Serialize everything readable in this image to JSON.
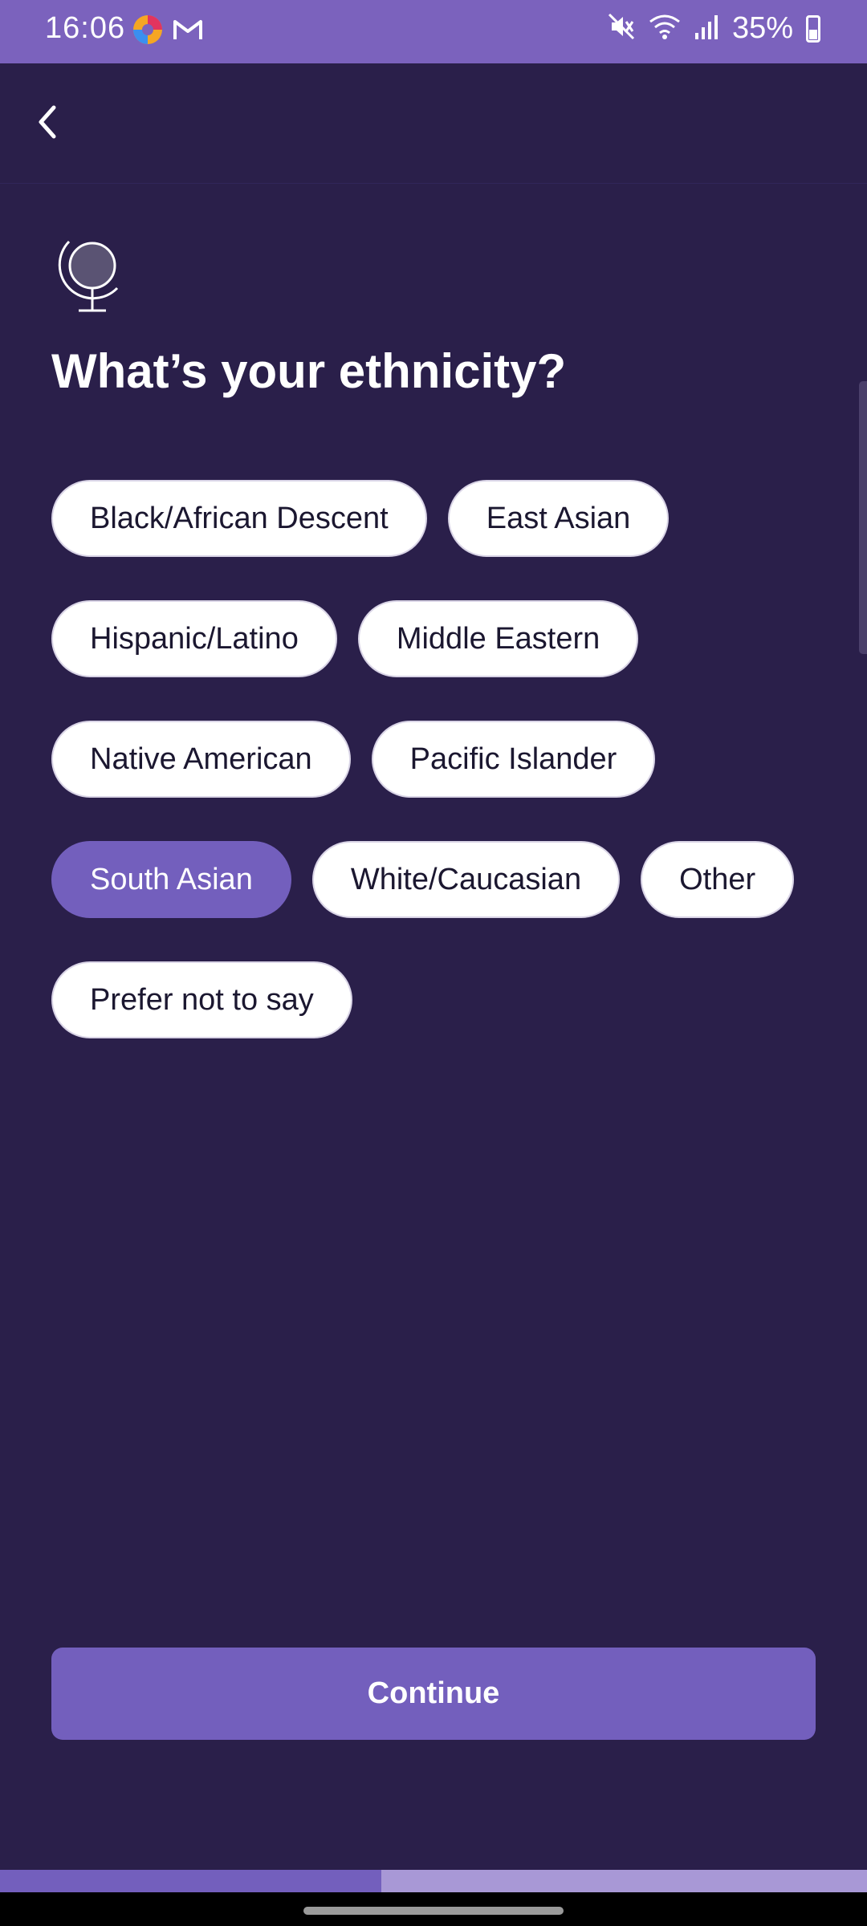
{
  "status_bar": {
    "time": "16:06",
    "battery_pct": "35%",
    "icons": [
      "firefox-icon",
      "gmail-icon",
      "mute-icon",
      "wifi-icon",
      "signal-icon",
      "battery-icon"
    ]
  },
  "header": {
    "back_icon": "chevron-left-icon"
  },
  "page": {
    "icon": "globe-icon",
    "title": "What’s your ethnicity?"
  },
  "options": [
    {
      "label": "Black/African Descent",
      "selected": false
    },
    {
      "label": "East Asian",
      "selected": false
    },
    {
      "label": "Hispanic/Latino",
      "selected": false
    },
    {
      "label": "Middle Eastern",
      "selected": false
    },
    {
      "label": "Native American",
      "selected": false
    },
    {
      "label": "Pacific Islander",
      "selected": false
    },
    {
      "label": "South Asian",
      "selected": true
    },
    {
      "label": "White/Caucasian",
      "selected": false
    },
    {
      "label": "Other",
      "selected": false
    },
    {
      "label": "Prefer not to say",
      "selected": false
    }
  ],
  "footer": {
    "continue_label": "Continue"
  },
  "progress": {
    "fraction": 0.44
  },
  "colors": {
    "background": "#2a1f4a",
    "accent": "#735fbd",
    "status_bar": "#7b62bd",
    "progress_track": "#a898d6"
  }
}
